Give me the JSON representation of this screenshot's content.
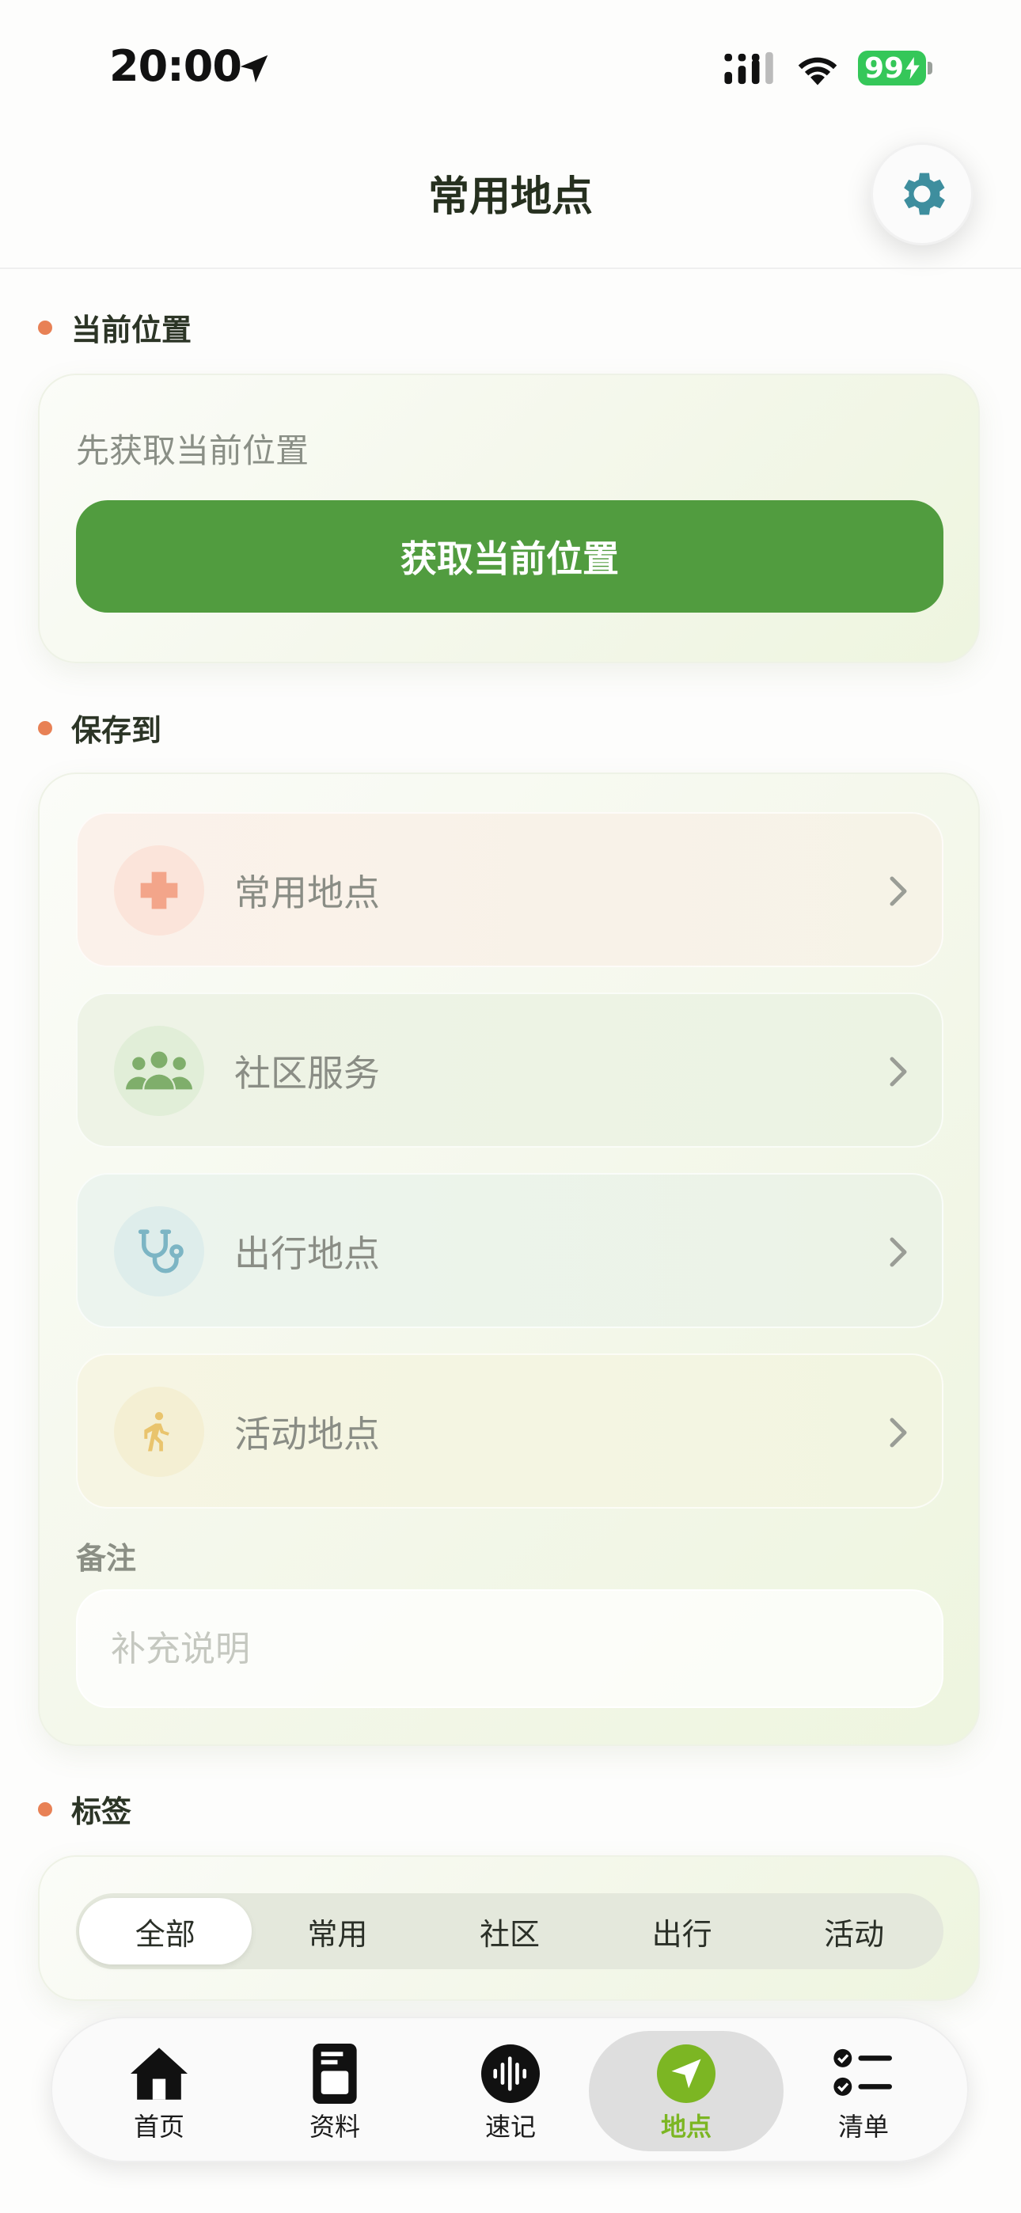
{
  "status_bar": {
    "time": "20:00",
    "battery": "99"
  },
  "header": {
    "title": "常用地点"
  },
  "sections": {
    "current_location": "当前位置",
    "save_to": "保存到",
    "tags": "标签"
  },
  "current_location": {
    "hint": "先获取当前位置",
    "button_label": "获取当前位置"
  },
  "destinations": [
    {
      "label": "常用地点",
      "icon": "medical-cross-icon",
      "color": "#f3a58a"
    },
    {
      "label": "社区服务",
      "icon": "people-group-icon",
      "color": "#7fae6b"
    },
    {
      "label": "出行地点",
      "icon": "stethoscope-icon",
      "color": "#7cb5c4"
    },
    {
      "label": "活动地点",
      "icon": "walking-person-icon",
      "color": "#e9c46d"
    }
  ],
  "note": {
    "label": "备注",
    "placeholder": "补充说明"
  },
  "tag_filters": [
    "全部",
    "常用",
    "社区",
    "出行",
    "活动"
  ],
  "tag_filter_selected": "全部",
  "tab_bar": [
    {
      "label": "首页",
      "icon": "home-icon"
    },
    {
      "label": "资料",
      "icon": "document-icon"
    },
    {
      "label": "速记",
      "icon": "voice-wave-icon"
    },
    {
      "label": "地点",
      "icon": "location-arrow-icon",
      "active": true
    },
    {
      "label": "清单",
      "icon": "checklist-icon"
    }
  ],
  "colors": {
    "primary_green": "#519c3f",
    "accent_orange": "#e88155",
    "active_tab": "#7cb623",
    "settings_gear": "#3e8e9e"
  }
}
